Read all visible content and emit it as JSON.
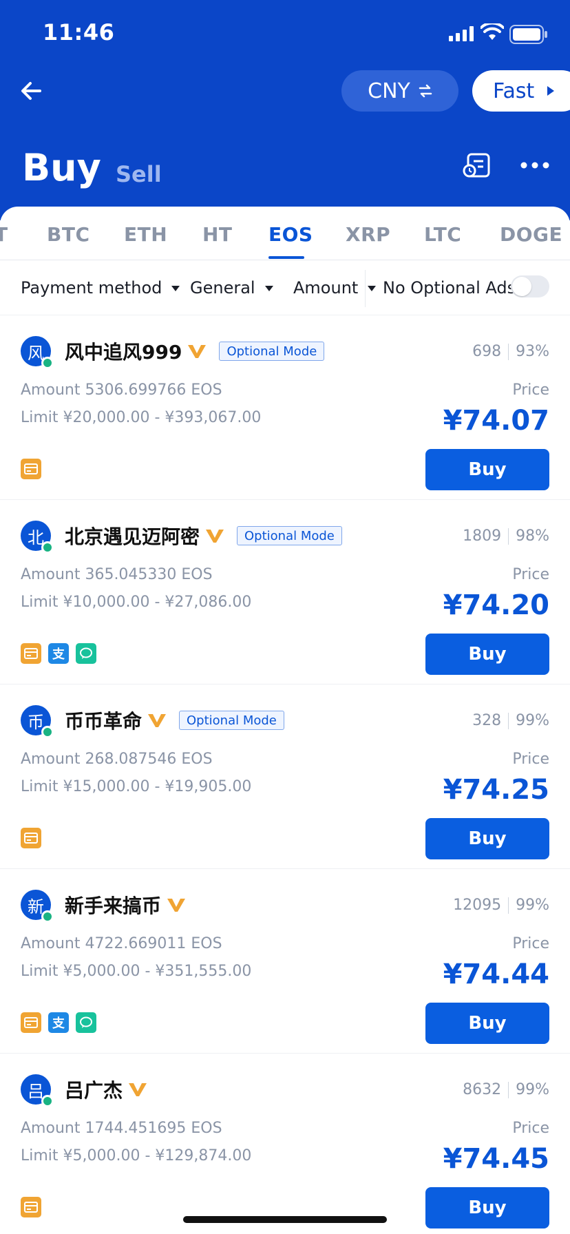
{
  "status_bar": {
    "time": "11:46"
  },
  "header": {
    "currency": "CNY",
    "fast_label": "Fast",
    "title": "Buy",
    "sell_tab": "Sell"
  },
  "coin_tabs": [
    {
      "label": "T"
    },
    {
      "label": "BTC"
    },
    {
      "label": "ETH"
    },
    {
      "label": "HT"
    },
    {
      "label": "EOS"
    },
    {
      "label": "XRP"
    },
    {
      "label": "LTC"
    },
    {
      "label": "DOGE"
    }
  ],
  "active_coin": "EOS",
  "filters": {
    "payment_method": "Payment method",
    "general": "General",
    "amount": "Amount",
    "no_optional_ads": "No Optional Ads",
    "no_optional_ads_on": false
  },
  "listings": [
    {
      "avatar": "风",
      "name": "风中追风999",
      "optional": "Optional Mode",
      "orders": "698",
      "rate": "93%",
      "amount": "Amount 5306.699766 EOS",
      "limit": "Limit ¥20,000.00 - ¥393,067.00",
      "price_label": "Price",
      "price": "¥74.07",
      "buy": "Buy",
      "payments": [
        "bank-card-icon"
      ]
    },
    {
      "avatar": "北",
      "name": "北京遇见迈阿密",
      "optional": "Optional Mode",
      "orders": "1809",
      "rate": "98%",
      "amount": "Amount 365.045330 EOS",
      "limit": "Limit ¥10,000.00 - ¥27,086.00",
      "price_label": "Price",
      "price": "¥74.20",
      "buy": "Buy",
      "payments": [
        "bank-card-icon",
        "alipay-icon",
        "wechat-icon"
      ]
    },
    {
      "avatar": "币",
      "name": "币币革命",
      "optional": "Optional Mode",
      "orders": "328",
      "rate": "99%",
      "amount": "Amount 268.087546 EOS",
      "limit": "Limit ¥15,000.00 - ¥19,905.00",
      "price_label": "Price",
      "price": "¥74.25",
      "buy": "Buy",
      "payments": [
        "bank-card-icon"
      ]
    },
    {
      "avatar": "新",
      "name": "新手来搞币",
      "optional": "",
      "orders": "12095",
      "rate": "99%",
      "amount": "Amount 4722.669011 EOS",
      "limit": "Limit ¥5,000.00 - ¥351,555.00",
      "price_label": "Price",
      "price": "¥74.44",
      "buy": "Buy",
      "payments": [
        "bank-card-icon",
        "alipay-icon",
        "wechat-icon"
      ]
    },
    {
      "avatar": "吕",
      "name": "吕广杰",
      "optional": "",
      "orders": "8632",
      "rate": "99%",
      "amount": "Amount 1744.451695 EOS",
      "limit": "Limit ¥5,000.00 - ¥129,874.00",
      "price_label": "Price",
      "price": "¥74.45",
      "buy": "Buy",
      "payments": [
        "bank-card-icon"
      ]
    }
  ],
  "colors": {
    "header_blue": "#0b46c8",
    "accent_blue": "#0a55d6",
    "button_blue": "#0a5ee0",
    "online_green": "#19b383",
    "vip_gold": "#f0a433"
  }
}
